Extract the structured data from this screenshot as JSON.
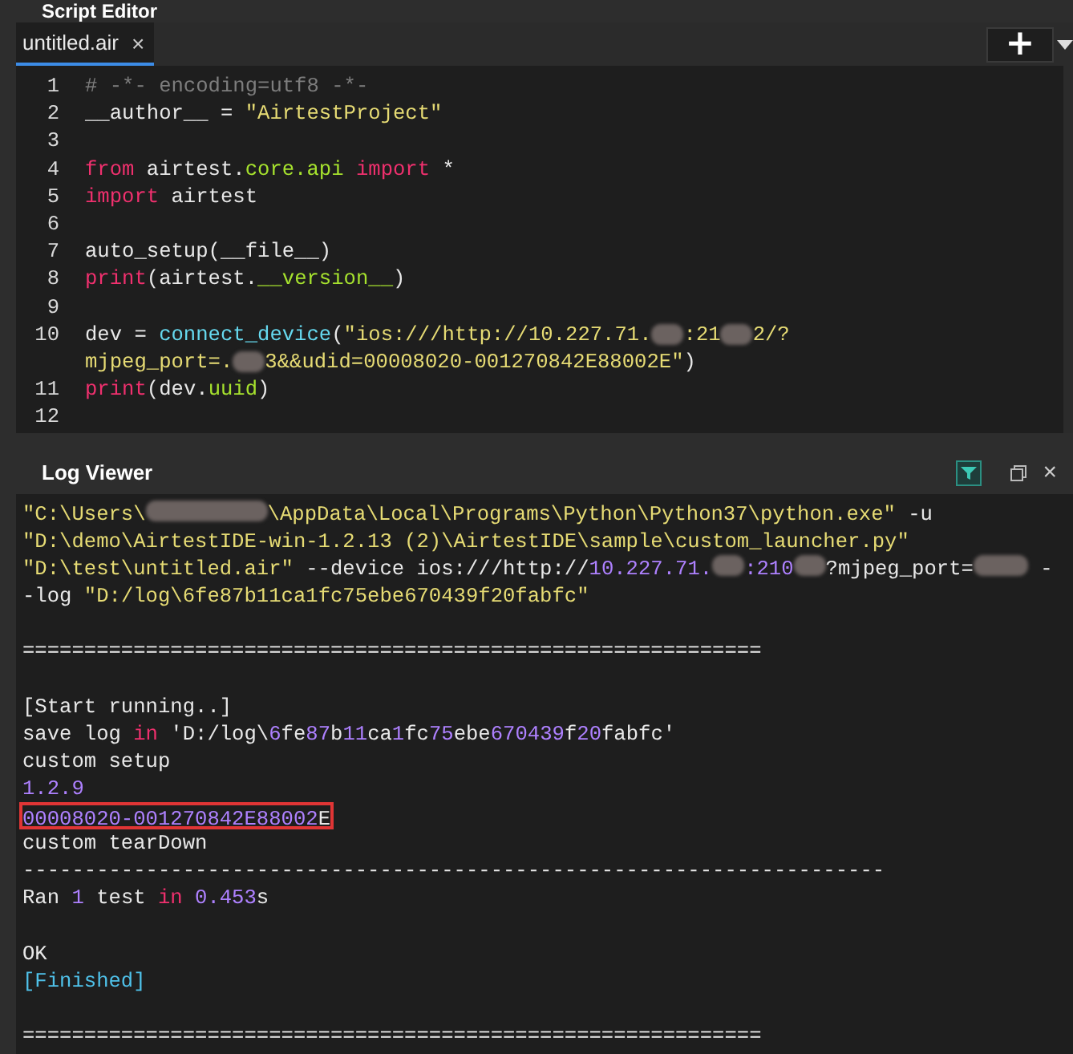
{
  "editor": {
    "title": "Script Editor",
    "tabs": [
      {
        "label": "untitled.air",
        "close": "×",
        "selected": true
      }
    ],
    "add_button": "+",
    "lines": [
      {
        "number": "1",
        "tokens": [
          {
            "t": "# -*- encoding=utf8 -*-",
            "kind": "comment"
          }
        ]
      },
      {
        "number": "2",
        "tokens": [
          {
            "t": "__author__ = ",
            "kind": "plain"
          },
          {
            "t": "\"AirtestProject\"",
            "kind": "string"
          }
        ]
      },
      {
        "number": "3"
      },
      {
        "number": "4",
        "tokens": [
          {
            "t": "from",
            "kind": "keyword"
          },
          {
            "t": " airtest.",
            "kind": "plain"
          },
          {
            "t": "core.api",
            "kind": "attr"
          },
          {
            "t": " import",
            "kind": "keyword"
          },
          {
            "t": " *",
            "kind": "plain"
          }
        ]
      },
      {
        "number": "5",
        "tokens": [
          {
            "t": "import",
            "kind": "keyword"
          },
          {
            "t": " airtest",
            "kind": "plain"
          }
        ]
      },
      {
        "number": "6"
      },
      {
        "number": "7",
        "tokens": [
          {
            "t": "auto_setup(__file__)",
            "kind": "plain"
          }
        ]
      },
      {
        "number": "8",
        "tokens": [
          {
            "t": "print",
            "kind": "keyword"
          },
          {
            "t": "(airtest.",
            "kind": "plain"
          },
          {
            "t": "__version__",
            "kind": "attr"
          },
          {
            "t": ")",
            "kind": "plain"
          }
        ]
      },
      {
        "number": "9"
      },
      {
        "number": "10",
        "tokens": [
          {
            "t": "dev = ",
            "kind": "plain"
          },
          {
            "t": "connect_device",
            "kind": "function"
          },
          {
            "t": "(",
            "kind": "plain"
          },
          {
            "t": "\"ios:///http://10.227.71.",
            "kind": "string"
          },
          {
            "kind": "redacted"
          },
          {
            "t": ":21",
            "kind": "string"
          },
          {
            "kind": "redacted"
          },
          {
            "t": "2/?",
            "kind": "string"
          }
        ]
      },
      {
        "tokens": [
          {
            "t": "mjpeg_port=.",
            "kind": "string"
          },
          {
            "kind": "redacted"
          },
          {
            "t": "3&&udid=00008020-001270842E88002E\"",
            "kind": "string"
          },
          {
            "t": ")",
            "kind": "plain"
          }
        ]
      },
      {
        "number": "11",
        "tokens": [
          {
            "t": "print",
            "kind": "keyword"
          },
          {
            "t": "(dev.",
            "kind": "plain"
          },
          {
            "t": "uuid",
            "kind": "attr"
          },
          {
            "t": ")",
            "kind": "plain"
          }
        ]
      },
      {
        "number": "12"
      }
    ]
  },
  "log_viewer": {
    "title": "Log Viewer",
    "close": "×",
    "blocks": [
      {
        "lines": [
          {
            "tokens": [
              {
                "t": "\"C:\\Users\\",
                "kind": "string"
              },
              {
                "kind": "redacted_wide"
              },
              {
                "t": "\\AppData\\Local\\Programs\\Python\\Python37\\python.exe\"",
                "kind": "string"
              },
              {
                "t": " -u",
                "kind": "plain"
              }
            ]
          },
          {
            "tokens": [
              {
                "t": "\"D:\\demo\\AirtestIDE-win-1.2.13 (2)\\AirtestIDE\\sample\\custom_launcher.py\"",
                "kind": "string"
              }
            ]
          },
          {
            "tokens": [
              {
                "t": "\"D:\\test\\untitled.air\"",
                "kind": "string"
              },
              {
                "t": " --device ios:///http://",
                "kind": "plain"
              },
              {
                "t": "10.227.71.",
                "kind": "number"
              },
              {
                "kind": "redacted"
              },
              {
                "t": ":210",
                "kind": "number"
              },
              {
                "kind": "redacted"
              },
              {
                "t": "?mjpeg_port=",
                "kind": "plain"
              },
              {
                "kind": "redacted_long"
              },
              {
                "t": " -",
                "kind": "plain"
              }
            ]
          },
          {
            "tokens": [
              {
                "t": "-log ",
                "kind": "plain"
              },
              {
                "t": "\"D:/log\\6fe87b11ca1fc75ebe670439f20fabfc\"",
                "kind": "string"
              }
            ]
          }
        ]
      },
      {
        "lines": [
          {
            "tokens": [
              {
                "t": "============================================================",
                "kind": "plain"
              }
            ]
          }
        ]
      },
      {
        "lines": [
          {
            "tokens": [
              {
                "t": "[Start running..]",
                "kind": "plain"
              }
            ]
          },
          {
            "tokens": [
              {
                "t": "save log ",
                "kind": "plain"
              },
              {
                "t": "in",
                "kind": "keyword"
              },
              {
                "t": " 'D:/log\\",
                "kind": "plain"
              },
              {
                "t": "6",
                "kind": "number"
              },
              {
                "t": "fe",
                "kind": "plain"
              },
              {
                "t": "87",
                "kind": "number"
              },
              {
                "t": "b",
                "kind": "plain"
              },
              {
                "t": "11",
                "kind": "number"
              },
              {
                "t": "ca",
                "kind": "plain"
              },
              {
                "t": "1",
                "kind": "number"
              },
              {
                "t": "fc",
                "kind": "plain"
              },
              {
                "t": "75",
                "kind": "number"
              },
              {
                "t": "ebe",
                "kind": "plain"
              },
              {
                "t": "670439",
                "kind": "number"
              },
              {
                "t": "f",
                "kind": "plain"
              },
              {
                "t": "20",
                "kind": "number"
              },
              {
                "t": "fabfc'",
                "kind": "plain"
              }
            ]
          },
          {
            "tokens": [
              {
                "t": "custom setup",
                "kind": "plain"
              }
            ]
          },
          {
            "tokens": [
              {
                "t": "1.2.9",
                "kind": "number"
              }
            ]
          },
          {
            "boxed": true,
            "tokens": [
              {
                "t": "00008020-001270842E88002",
                "kind": "number"
              },
              {
                "t": "E",
                "kind": "plain"
              }
            ]
          },
          {
            "tokens": [
              {
                "t": "custom tearDown",
                "kind": "plain"
              }
            ]
          },
          {
            "tokens": [
              {
                "t": "----------------------------------------------------------------------",
                "kind": "plain"
              }
            ]
          },
          {
            "tokens": [
              {
                "t": "Ran ",
                "kind": "plain"
              },
              {
                "t": "1",
                "kind": "number"
              },
              {
                "t": " test ",
                "kind": "plain"
              },
              {
                "t": "in",
                "kind": "keyword"
              },
              {
                "t": " 0.453",
                "kind": "number"
              },
              {
                "t": "s",
                "kind": "plain"
              }
            ]
          }
        ]
      },
      {
        "lines": [
          {
            "tokens": [
              {
                "t": "OK",
                "kind": "plain"
              }
            ]
          },
          {
            "tokens": [
              {
                "t": "[Finished]",
                "kind": "cyan"
              }
            ]
          }
        ]
      },
      {
        "lines": [
          {
            "tokens": [
              {
                "t": "============================================================",
                "kind": "plain"
              }
            ]
          }
        ]
      }
    ]
  }
}
